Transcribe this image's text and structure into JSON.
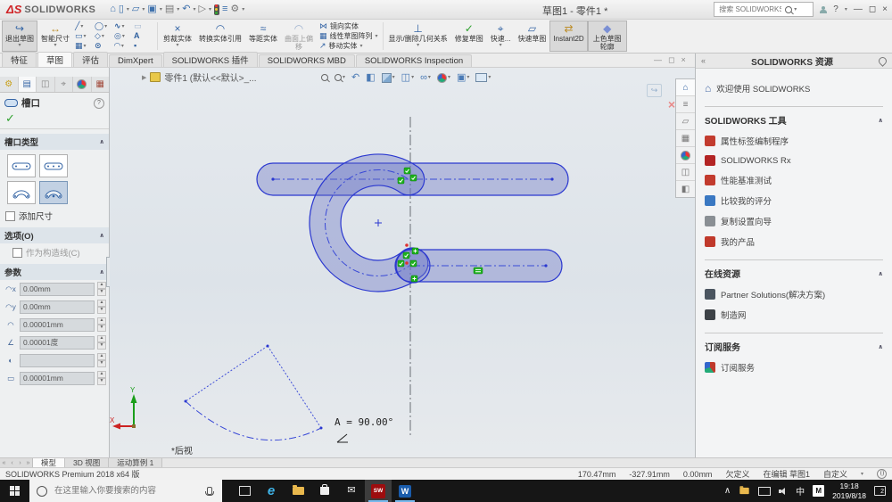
{
  "icons": {
    "caret": "▾",
    "up": "∧",
    "chevrons_left": "«",
    "home": "⌂",
    "new": "▯",
    "open": "▱",
    "save": "▣",
    "print": "▤",
    "undo": "↶",
    "select": "▷",
    "props": "≡",
    "options": "⚙",
    "help": "?",
    "min": "—",
    "restore": "◻",
    "close": "×",
    "flyout": "▶",
    "line": "╱",
    "circle": "◯",
    "spline": "∿",
    "rect": "▭",
    "polygon": "◇",
    "circ2": "◎",
    "text_a": "A",
    "pattern": "▦",
    "point": "⊙",
    "arc": "◠",
    "dot": "▪",
    "exit_arrow": "↪",
    "smart_dim": "↔",
    "trim": "×",
    "convert": "◠",
    "offset": "≈",
    "mirror": "⋈",
    "linear": "▦",
    "move": "↗",
    "relations": "⊥",
    "repair_check": "✓",
    "snaps": "⌖",
    "rapid": "▱",
    "instant": "⇄",
    "shaded": "◆",
    "zoom_prev": "↶",
    "section": "◧",
    "display_style": "◫",
    "glasses": "∞",
    "scene": "▣",
    "nav_first": "«",
    "nav_prev": "‹",
    "nav_next": "›",
    "nav_last": "»",
    "pm_tab1": "⚙",
    "pm_tab2": "▤",
    "pm_tab3": "◫",
    "pm_tab4": "⌖",
    "pm_tab6": "▦",
    "check": "✓",
    "mail": "✉",
    "tray_up": "∧",
    "param_icons": [
      "◠x",
      "◠y",
      "◠",
      "∠",
      "◐",
      "▭"
    ]
  },
  "titlebar": {
    "logo": "SOLIDWORKS",
    "doc_title": "草图1 - 零件1 *",
    "search_placeholder": "搜索 SOLIDWORKS 帮助"
  },
  "ribbon": {
    "exit_sketch": "退出草图",
    "smart_dimension": "智能尺寸",
    "trim": "剪裁实体",
    "convert": "转换实体引用",
    "offset": "等距实体",
    "offset_on_surface": "曲面上偏移",
    "mirror": "镜向实体",
    "linear_pattern": "线性草图阵列",
    "move": "移动实体",
    "relations": "显示/删除几何关系",
    "repair": "修复草图",
    "quick_snaps": "快速...",
    "rapid_sketch": "快速草图",
    "instant2d": "Instant2D",
    "shaded_contours": "上色草图轮廓"
  },
  "tabs": [
    "特征",
    "草图",
    "评估",
    "DimXpert",
    "SOLIDWORKS 插件",
    "SOLIDWORKS MBD",
    "SOLIDWORKS Inspection"
  ],
  "feature_tree": {
    "root": "零件1 (默认<<默认>_..."
  },
  "property_panel": {
    "title": "槽口",
    "slot_type_section": "槽口类型",
    "options_section": "选项(O)",
    "parameters_section": "参数",
    "add_dimension": "添加尺寸",
    "construction": "作为构造线(C)",
    "param_values": [
      "0.00mm",
      "0.00mm",
      "0.00001mm",
      "0.00001度",
      "",
      "0.00001mm"
    ]
  },
  "viewport": {
    "angle_annotation": "A = 90.00°",
    "view_label": "*后视",
    "triad": {
      "x": "X",
      "y": "Y"
    }
  },
  "task_pane": {
    "title": "SOLIDWORKS 资源",
    "welcome": "欢迎使用  SOLIDWORKS",
    "sections": [
      {
        "title": "SOLIDWORKS 工具",
        "items": [
          "属性标签编制程序",
          "SOLIDWORKS Rx",
          "性能基准测试",
          "比较我的评分",
          "复制设置向导",
          "我的产品"
        ]
      },
      {
        "title": "在线资源",
        "items": [
          "Partner Solutions(解决方案)",
          "制造网"
        ]
      },
      {
        "title": "订阅服务",
        "items": [
          "订阅服务"
        ]
      }
    ]
  },
  "sheet_tabs": [
    "模型",
    "3D 视图",
    "运动算例 1"
  ],
  "statusbar": {
    "version": "SOLIDWORKS Premium 2018 x64 版",
    "x": "170.47mm",
    "y": "-327.91mm",
    "z": "0.00mm",
    "state": "欠定义",
    "editing": "在编辑 草图1",
    "custom": "自定义"
  },
  "taskbar": {
    "search_placeholder": "在这里输入你要搜索的内容",
    "ime": "中",
    "lang": "M",
    "time": "19:18",
    "date": "2019/8/18",
    "notifications": "2"
  }
}
